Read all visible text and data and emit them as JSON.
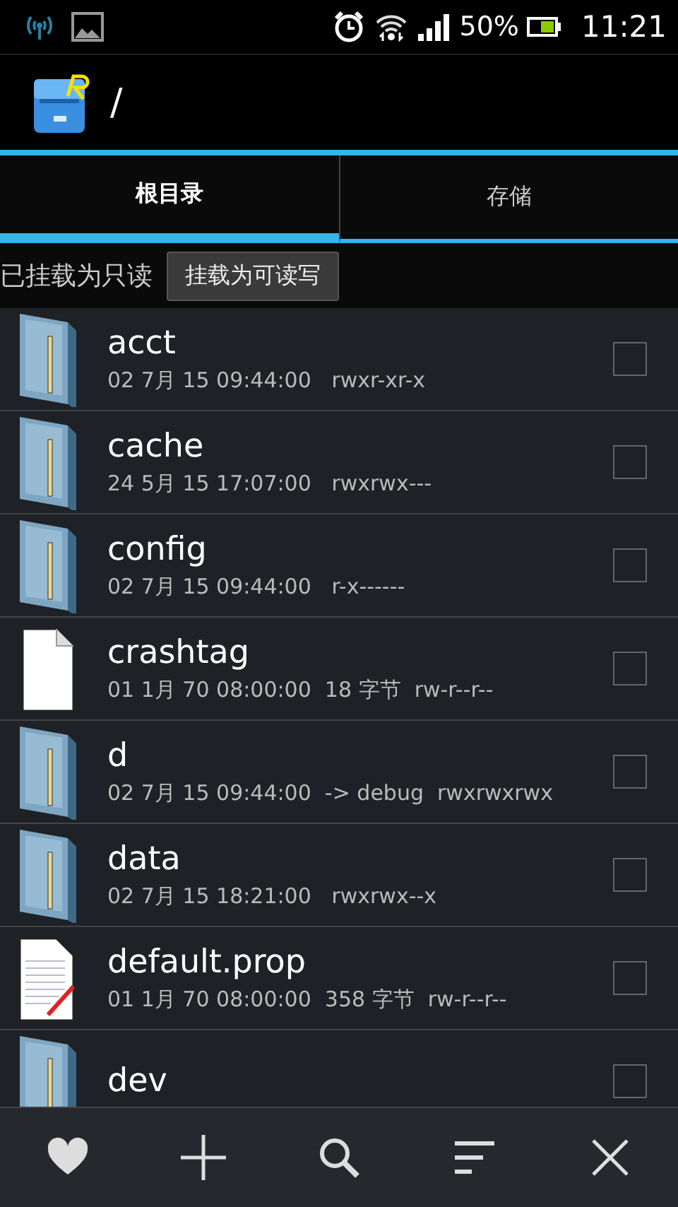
{
  "status_bar": {
    "battery": "50%",
    "time": "11:21"
  },
  "action_bar": {
    "path": "/"
  },
  "tabs": [
    {
      "label": "根目录",
      "selected": true
    },
    {
      "label": "存储",
      "selected": false
    }
  ],
  "mount": {
    "status": "已挂载为只读",
    "button": "挂载为可读写"
  },
  "files": [
    {
      "kind": "folder",
      "name": "acct",
      "meta": "02 7月 15 09:44:00   rwxr-xr-x",
      "checked": false
    },
    {
      "kind": "folder",
      "name": "cache",
      "meta": "24 5月 15 17:07:00   rwxrwx---",
      "checked": false
    },
    {
      "kind": "folder",
      "name": "config",
      "meta": "02 7月 15 09:44:00   r-x------",
      "checked": false
    },
    {
      "kind": "file",
      "name": "crashtag",
      "meta": "01 1月 70 08:00:00  18 字节  rw-r--r--",
      "checked": false
    },
    {
      "kind": "folder",
      "name": "d",
      "meta": "02 7月 15 09:44:00  -> debug  rwxrwxrwx",
      "checked": false
    },
    {
      "kind": "folder",
      "name": "data",
      "meta": "02 7月 15 18:21:00   rwxrwx--x",
      "checked": false
    },
    {
      "kind": "text",
      "name": "default.prop",
      "meta": "01 1月 70 08:00:00  358 字节  rw-r--r--",
      "checked": false
    },
    {
      "kind": "folder",
      "name": "dev",
      "checked": false
    }
  ],
  "toolbar": [
    {
      "kind": "heart"
    },
    {
      "kind": "plus"
    },
    {
      "kind": "search"
    },
    {
      "kind": "sort"
    },
    {
      "kind": "close"
    }
  ]
}
